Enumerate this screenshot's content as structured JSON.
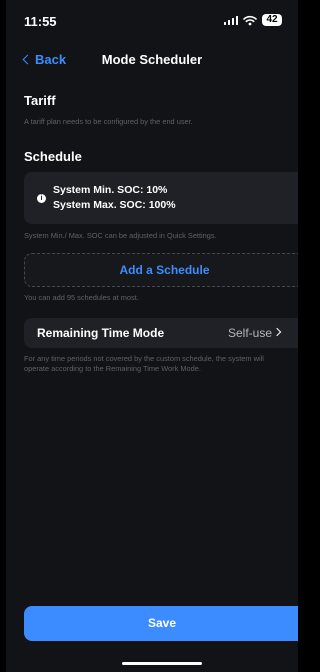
{
  "status_bar": {
    "time": "11:55",
    "battery": "42",
    "icons": [
      "signal-icon",
      "wifi-icon",
      "battery-icon"
    ]
  },
  "nav": {
    "back_label": "Back",
    "title": "Mode Scheduler"
  },
  "tariff": {
    "title": "Tariff",
    "hint": "A tariff plan needs to be configured by the end user."
  },
  "schedule": {
    "title": "Schedule",
    "soc_min": "System Min. SOC: 10%",
    "soc_max": "System Max. SOC: 100%",
    "soc_hint": "System Min./ Max. SOC can be adjusted in Quick Settings.",
    "add_label": "Add a Schedule",
    "add_hint": "You can add 95 schedules at most."
  },
  "remaining": {
    "label": "Remaining Time Mode",
    "value": "Self-use",
    "hint": "For any time periods not covered by the custom schedule, the system will operate according to the Remaining Time Work Mode."
  },
  "save_label": "Save",
  "colors": {
    "accent": "#3c8cff",
    "background": "#121316",
    "card": "#1f2126",
    "hint_text": "#5e6168"
  }
}
